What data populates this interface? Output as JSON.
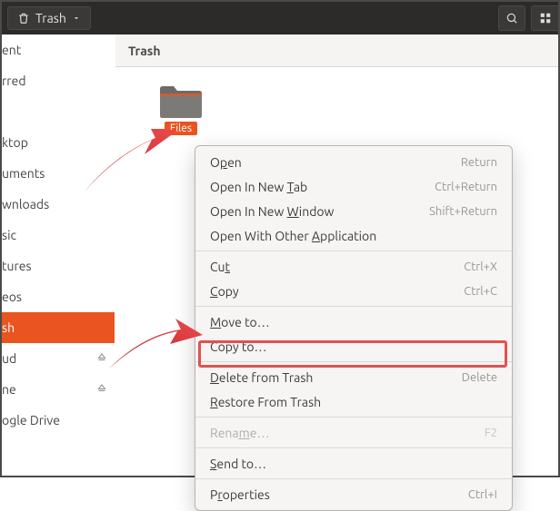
{
  "topbar": {
    "title": "Trash",
    "search_icon": "search",
    "grid_icon": "view-grid"
  },
  "sidebar": {
    "items": [
      {
        "label": "ent",
        "eject": false
      },
      {
        "label": "rred",
        "eject": false
      },
      {
        "label": "",
        "eject": false
      },
      {
        "label": "ktop",
        "eject": false
      },
      {
        "label": "uments",
        "eject": false
      },
      {
        "label": "wnloads",
        "eject": false
      },
      {
        "label": "sic",
        "eject": false
      },
      {
        "label": "tures",
        "eject": false
      },
      {
        "label": "eos",
        "eject": false
      },
      {
        "label": "sh",
        "eject": false,
        "selected": true
      },
      {
        "label": "ud",
        "eject": true
      },
      {
        "label": "ne",
        "eject": true
      },
      {
        "label": "ogle Drive",
        "eject": false
      }
    ]
  },
  "location": {
    "title": "Trash"
  },
  "folder": {
    "name": "Files"
  },
  "ctxmenu": {
    "open": {
      "label_pre": "O",
      "label_u": "p",
      "label_post": "en",
      "shortcut": "Return"
    },
    "open_tab": {
      "label_pre": "Open In New ",
      "label_u": "T",
      "label_post": "ab",
      "shortcut": "Ctrl+Return"
    },
    "open_window": {
      "label_pre": "Open In New ",
      "label_u": "W",
      "label_post": "indow",
      "shortcut": "Shift+Return"
    },
    "open_with": {
      "label_pre": "Open With Other ",
      "label_u": "A",
      "label_post": "pplication",
      "shortcut": ""
    },
    "cut": {
      "label_pre": "Cu",
      "label_u": "t",
      "label_post": "",
      "shortcut": "Ctrl+X"
    },
    "copy": {
      "label_pre": "",
      "label_u": "C",
      "label_post": "opy",
      "shortcut": "Ctrl+C"
    },
    "move_to": {
      "label_pre": "",
      "label_u": "M",
      "label_post": "ove to…",
      "shortcut": ""
    },
    "copy_to": {
      "label_pre": "Copy to…",
      "label_u": "",
      "label_post": "",
      "shortcut": ""
    },
    "delete": {
      "label_pre": "",
      "label_u": "D",
      "label_post": "elete from Trash",
      "shortcut": "Delete"
    },
    "restore": {
      "label_pre": "",
      "label_u": "R",
      "label_post": "estore From Trash",
      "shortcut": ""
    },
    "rename": {
      "label_pre": "Rena",
      "label_u": "m",
      "label_post": "e…",
      "shortcut": "F2"
    },
    "send_to": {
      "label_pre": "",
      "label_u": "S",
      "label_post": "end to…",
      "shortcut": ""
    },
    "properties": {
      "label_pre": "P",
      "label_u": "r",
      "label_post": "operties",
      "shortcut": "Ctrl+I"
    }
  },
  "colors": {
    "accent": "#e95420",
    "highlight_border": "#e0524f"
  }
}
